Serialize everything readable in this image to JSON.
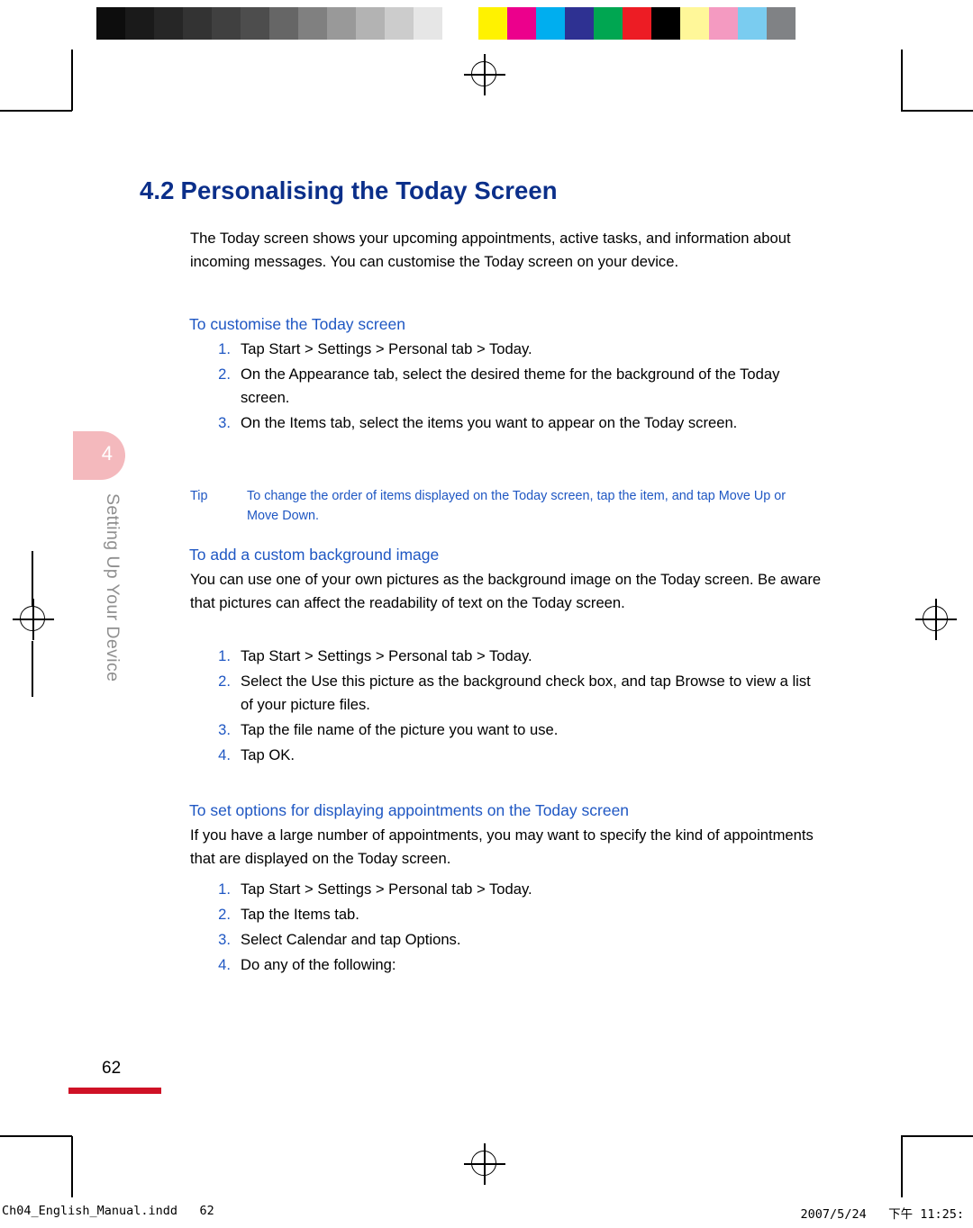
{
  "calibration": {
    "gray_swatches": [
      "#0d0d0d",
      "#1a1a1a",
      "#262626",
      "#333333",
      "#404040",
      "#4d4d4d",
      "#666666",
      "#808080",
      "#999999",
      "#b3b3b3",
      "#cccccc",
      "#e6e6e6",
      "#ffffff"
    ],
    "color_swatches": [
      "#fff200",
      "#ec008c",
      "#00aeef",
      "#2e3192",
      "#00a651",
      "#ed1c24",
      "#000000",
      "#fff799",
      "#f49ac1",
      "#7accf0",
      "#808285"
    ]
  },
  "document": {
    "section_number": "4.2",
    "section_title": "Personalising the Today Screen",
    "intro": "The Today screen shows your upcoming appointments, active tasks, and information about incoming messages. You can customise the Today screen on your device.",
    "subsection_1": {
      "heading": "To customise the Today screen",
      "steps": [
        {
          "marker": "1.",
          "text": "Tap Start > Settings > Personal tab > Today."
        },
        {
          "marker": "2.",
          "text": "On the Appearance tab, select the desired theme for the background of the Today screen."
        },
        {
          "marker": "3.",
          "text": "On the Items tab, select the items you want to appear on the Today screen."
        }
      ],
      "tip_label": "Tip",
      "tip_text": "To change the order of items displayed on the Today screen, tap the item, and tap Move Up or Move Down."
    },
    "subsection_2": {
      "heading": "To add a custom background image",
      "paragraph": "You can use one of your own pictures as the background image on the Today screen. Be aware that pictures can affect the readability of text on the Today screen.",
      "steps": [
        {
          "marker": "1.",
          "text": "Tap Start > Settings > Personal tab > Today."
        },
        {
          "marker": "2.",
          "text": "Select the Use this picture as the background check box, and tap Browse to view a list of your picture files."
        },
        {
          "marker": "3.",
          "text": "Tap the file name of the picture you want to use."
        },
        {
          "marker": "4.",
          "text": "Tap OK."
        }
      ]
    },
    "subsection_3": {
      "heading": "To set options for displaying appointments on the Today screen",
      "paragraph": "If you have a large number of appointments, you may want to specify the kind of appointments that are displayed on the Today screen.",
      "steps": [
        {
          "marker": "1.",
          "text": "Tap Start > Settings > Personal tab > Today."
        },
        {
          "marker": "2.",
          "text": "Tap the Items tab."
        },
        {
          "marker": "3.",
          "text": "Select Calendar and tap Options."
        },
        {
          "marker": "4.",
          "text": "Do any of the following:"
        }
      ]
    },
    "chapter_tab_number": "4",
    "chapter_vertical_label": "Setting Up Your Device",
    "page_number": "62"
  },
  "print_footer": {
    "filename": "Ch04_English_Manual.indd",
    "folio": "62",
    "date": "2007/5/24",
    "time": "下午 11:25:"
  },
  "colors": {
    "heading_blue": "#0b2f8a",
    "subhead_blue": "#1f57c3",
    "tab_pink": "#f4b9bd",
    "rule_red": "#cf1126",
    "vertical_label_gray": "#8f8f8f"
  }
}
